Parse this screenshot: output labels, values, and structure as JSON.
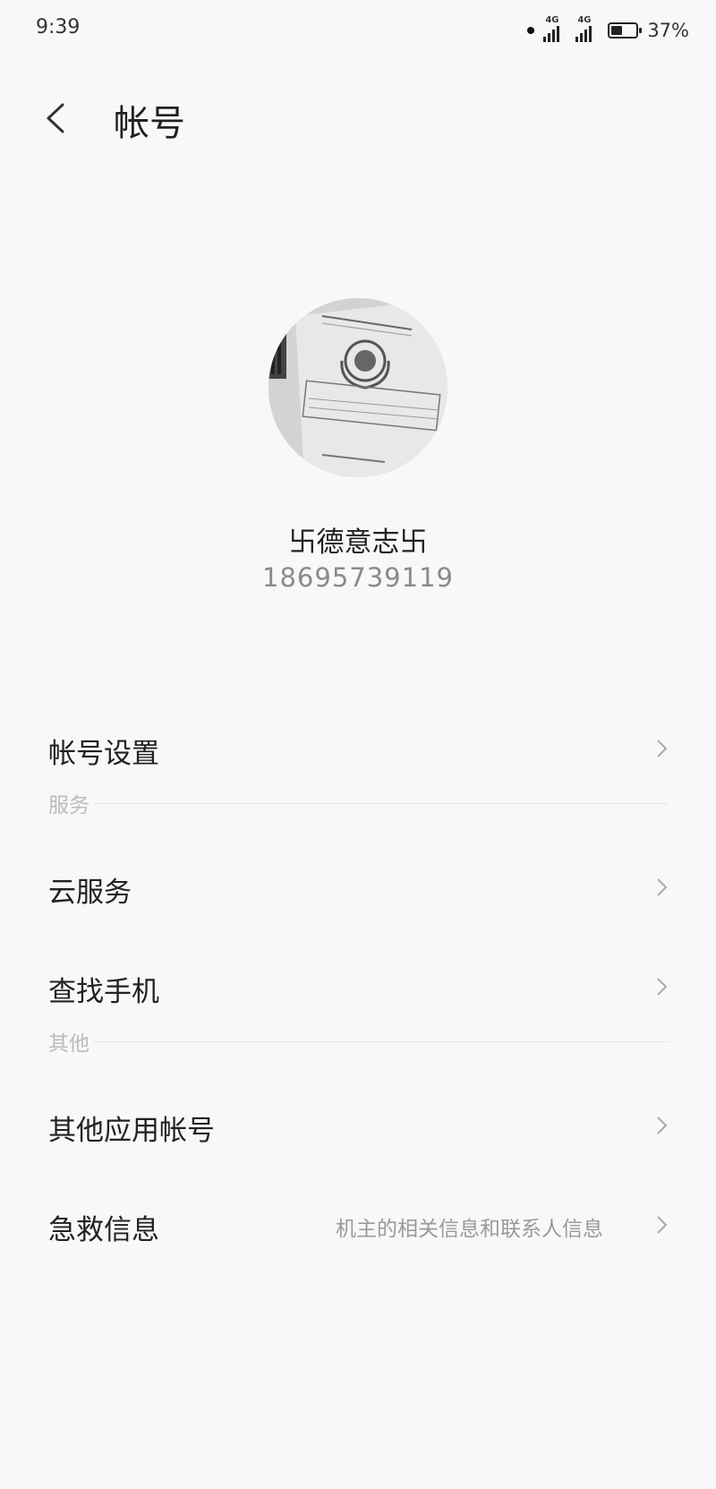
{
  "status_bar": {
    "time": "9:39",
    "signal1": "4G",
    "signal2": "4G",
    "battery_percent": "37%",
    "battery_level": 0.37
  },
  "header": {
    "back_icon": "chevron-left-icon",
    "title": "帐号"
  },
  "profile": {
    "name": "卐德意志卐",
    "phone": "18695739119"
  },
  "rows": [
    {
      "label": "帐号设置",
      "sub": ""
    },
    {
      "label": "云服务",
      "sub": ""
    },
    {
      "label": "查找手机",
      "sub": ""
    },
    {
      "label": "其他应用帐号",
      "sub": ""
    },
    {
      "label": "急救信息",
      "sub": "机主的相关信息和联系人信息"
    }
  ],
  "sections": {
    "services": "服务",
    "other": "其他"
  }
}
